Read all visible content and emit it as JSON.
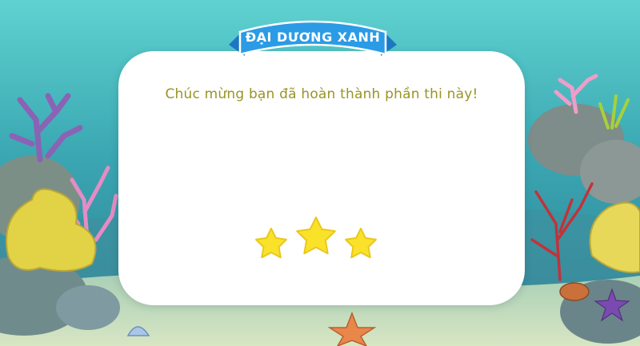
{
  "title": "ĐẠI DƯƠNG XANH",
  "message": "Chúc mừng bạn đã hoàn thành phần thi này!",
  "rating": {
    "earned": 3,
    "total": 3
  },
  "colors": {
    "star": "#fbe22a",
    "message_text": "#9a9424",
    "ribbon": "#2b9be6",
    "ocean_top": "#5fd2d0",
    "ocean_bottom": "#2f7b92",
    "sand": "#cfe0ba"
  }
}
